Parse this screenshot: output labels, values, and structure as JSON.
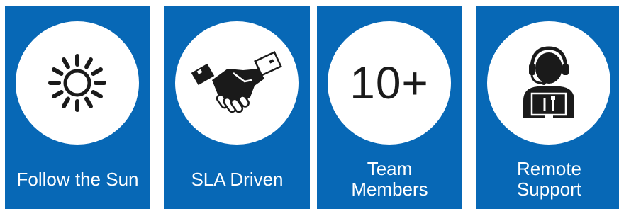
{
  "accent_color": "#0768b6",
  "cards": [
    {
      "icon": "sun-icon",
      "label": "Follow the Sun"
    },
    {
      "icon": "handshake-icon",
      "label": "SLA Driven"
    },
    {
      "icon_text": "10+",
      "label": "Team\nMembers"
    },
    {
      "icon": "support-agent-icon",
      "label": "Remote\nSupport"
    }
  ]
}
